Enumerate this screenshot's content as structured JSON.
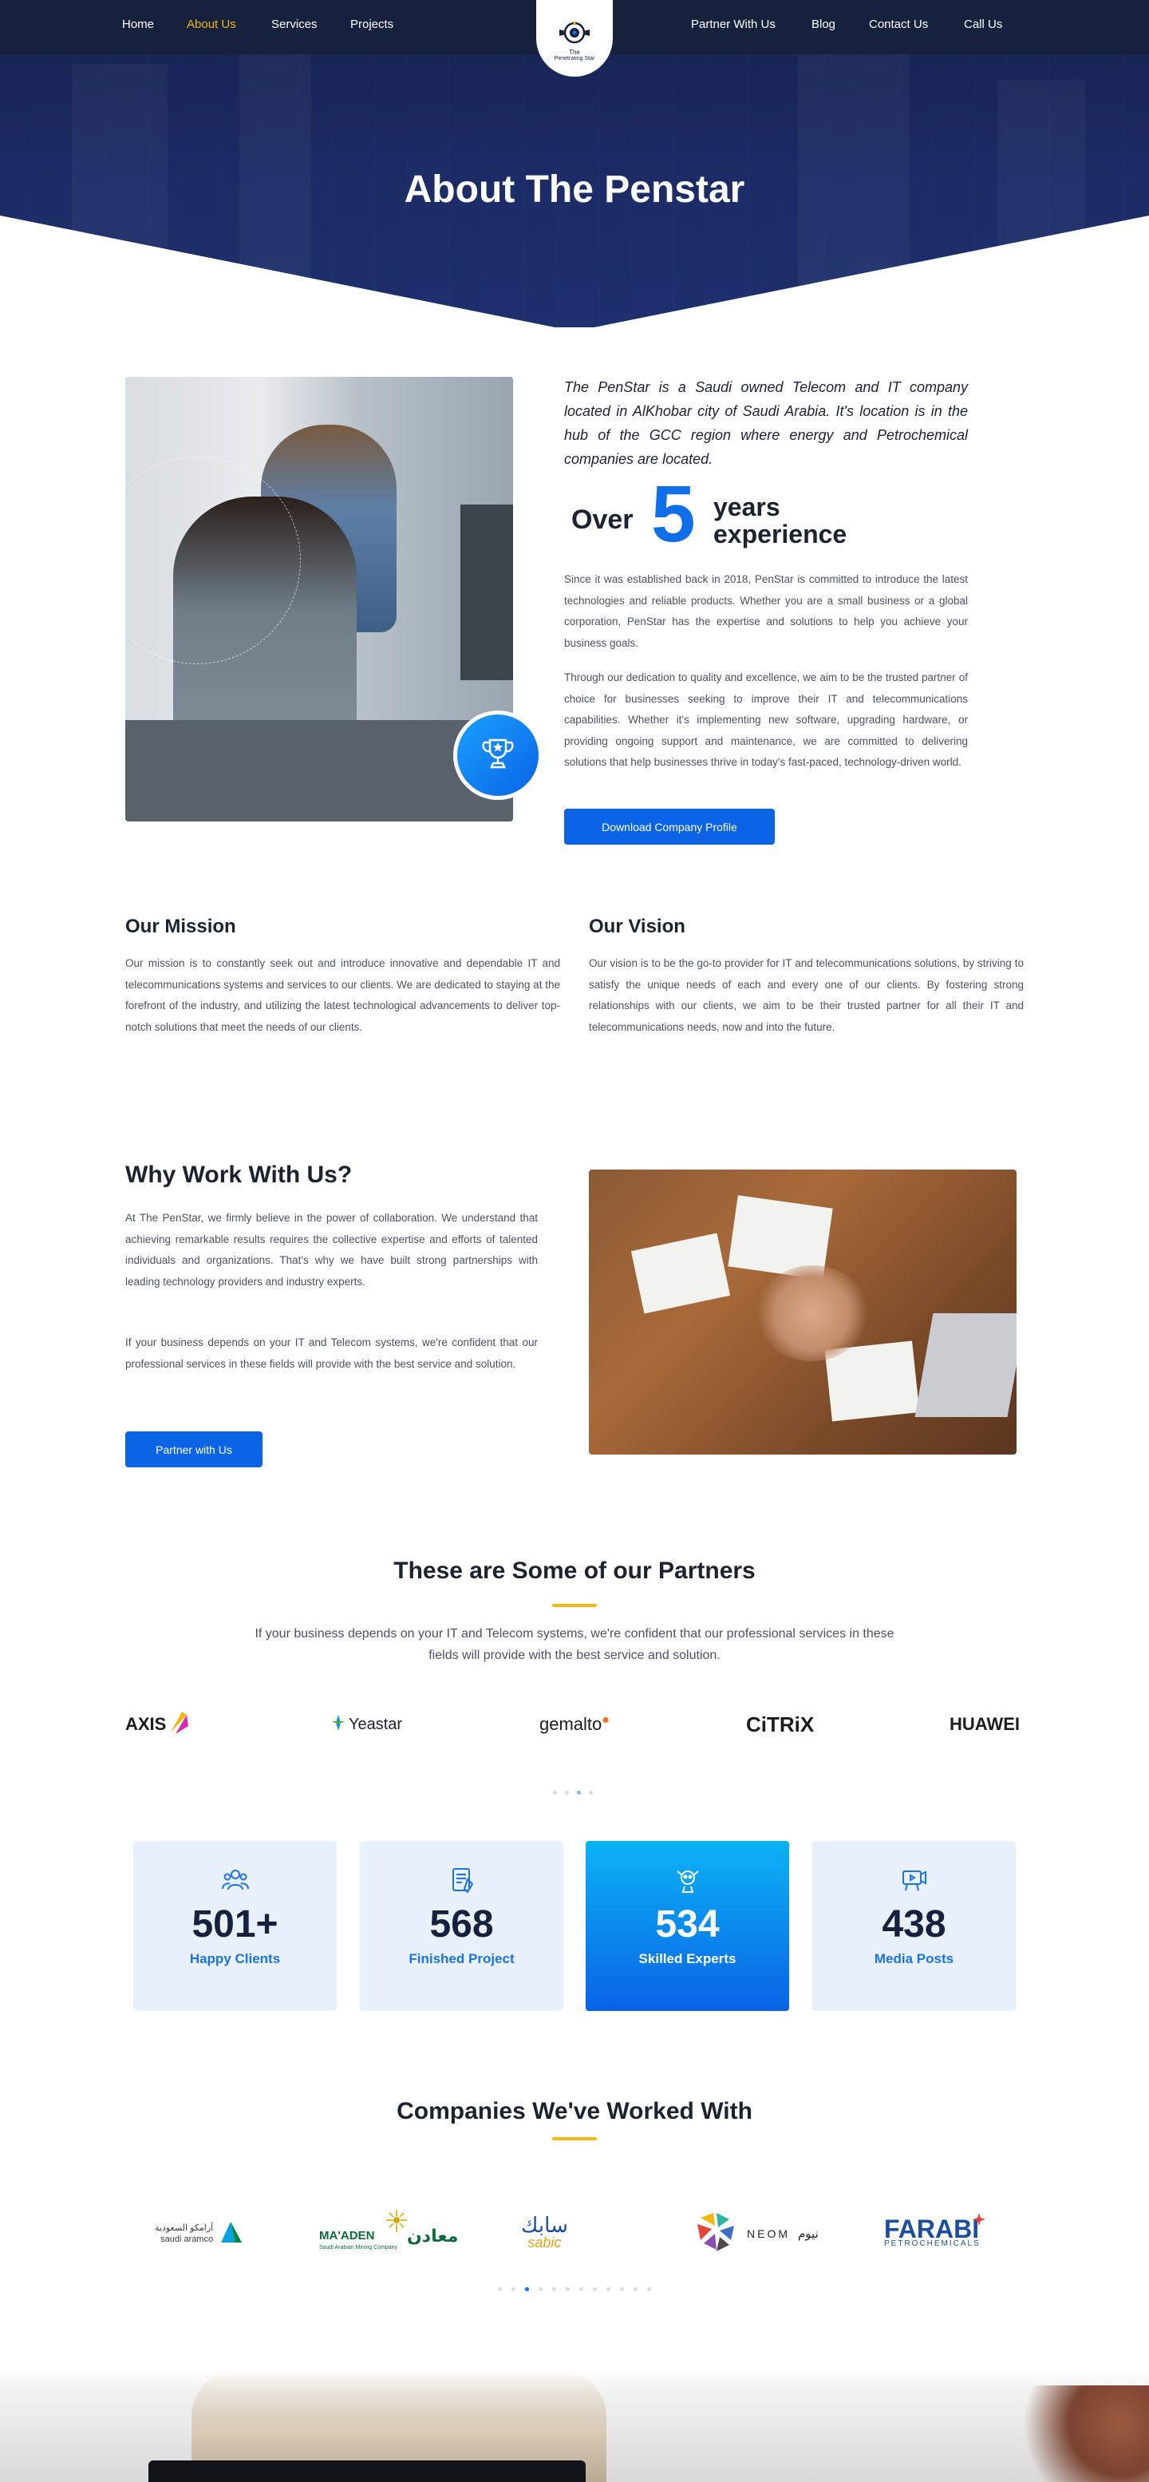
{
  "nav": {
    "left": [
      "Home",
      "About Us",
      "Services",
      "Projects"
    ],
    "right": [
      "Partner With Us",
      "Blog",
      "Contact Us",
      "Call Us"
    ],
    "active": "About Us",
    "logo_line1": "The",
    "logo_line2": "Penetrating Star"
  },
  "hero": {
    "title": "About The Penstar"
  },
  "about": {
    "intro": "The PenStar is a Saudi owned Telecom and IT company located in AlKhobar city of Saudi Arabia. It's location is in the hub of the GCC region where energy and Petrochemical companies are located.",
    "over": "Over",
    "years_number": "5",
    "years_line1": "years",
    "years_line2": "experience",
    "p1": "Since it was established back in 2018, PenStar is committed to introduce the latest technologies and reliable products. Whether you are a small business or a global corporation, PenStar has the expertise and solutions to help you achieve your business goals.",
    "p2": "Through our dedication to quality and excellence, we aim to be the trusted partner of choice for businesses seeking to improve their IT and telecommunications capabilities. Whether it's implementing new software, upgrading hardware, or providing ongoing support and maintenance, we are committed to delivering solutions that help businesses thrive in today's fast-paced, technology-driven world.",
    "button": "Download Company Profile"
  },
  "mission": {
    "title": "Our Mission",
    "text": "Our mission is to constantly seek out and introduce innovative and dependable IT and telecommunications systems and services to our clients. We are dedicated to staying at the forefront of the industry, and utilizing the latest technological advancements to deliver top-notch solutions that meet the needs of our clients."
  },
  "vision": {
    "title": "Our Vision",
    "text": "Our vision is to be the go-to provider for IT and telecommunications solutions, by striving to satisfy the unique needs of each and every one of our clients. By fostering strong relationships with our clients, we aim to be their trusted partner for all their IT and telecommunications needs, now and into the future."
  },
  "why": {
    "title": "Why Work With Us?",
    "p1": "At The PenStar, we firmly believe in the power of collaboration. We understand that achieving remarkable results requires the collective expertise and efforts of talented individuals and organizations. That's why we have built strong partnerships with leading technology providers and industry experts.",
    "p2": "If your business depends on your IT and Telecom systems, we're confident that our professional services in these fields will provide with the best service and solution.",
    "button": "Partner with Us"
  },
  "partners": {
    "title": "These are Some of our Partners",
    "subtitle": "If your business depends on your IT and Telecom systems, we're confident that our professional services in these fields will provide with the best service and solution.",
    "logos": [
      "AXIS",
      "Yeastar",
      "gemalto",
      "CiTRiX",
      "HUAWEI"
    ]
  },
  "stats": [
    {
      "number": "501+",
      "label": "Happy Clients",
      "icon": "people-icon"
    },
    {
      "number": "568",
      "label": "Finished Project",
      "icon": "document-check-icon"
    },
    {
      "number": "534",
      "label": "Skilled Experts",
      "icon": "expert-icon"
    },
    {
      "number": "438",
      "label": "Media Posts",
      "icon": "media-icon"
    }
  ],
  "companies": {
    "title": "Companies We've Worked With",
    "aramco_ar": "أرامكو السعودية",
    "aramco_en": "saudi aramco",
    "maaden_en": "MA'ADEN",
    "maaden_ar": "معادن",
    "maaden_sub": "Saudi Arabian Mining Company",
    "sabic_ar": "سابك",
    "sabic_en": "sabic",
    "neom_en": "NEOM",
    "neom_ar": "نيوم",
    "farabi_1": "FARABI",
    "farabi_2": "PETROCHEMICALS"
  },
  "colors": {
    "nav_bg": "#15213d",
    "accent_yellow": "#f5b70d",
    "primary_blue": "#0b63e5",
    "stat_bg": "#e8f1fd"
  }
}
